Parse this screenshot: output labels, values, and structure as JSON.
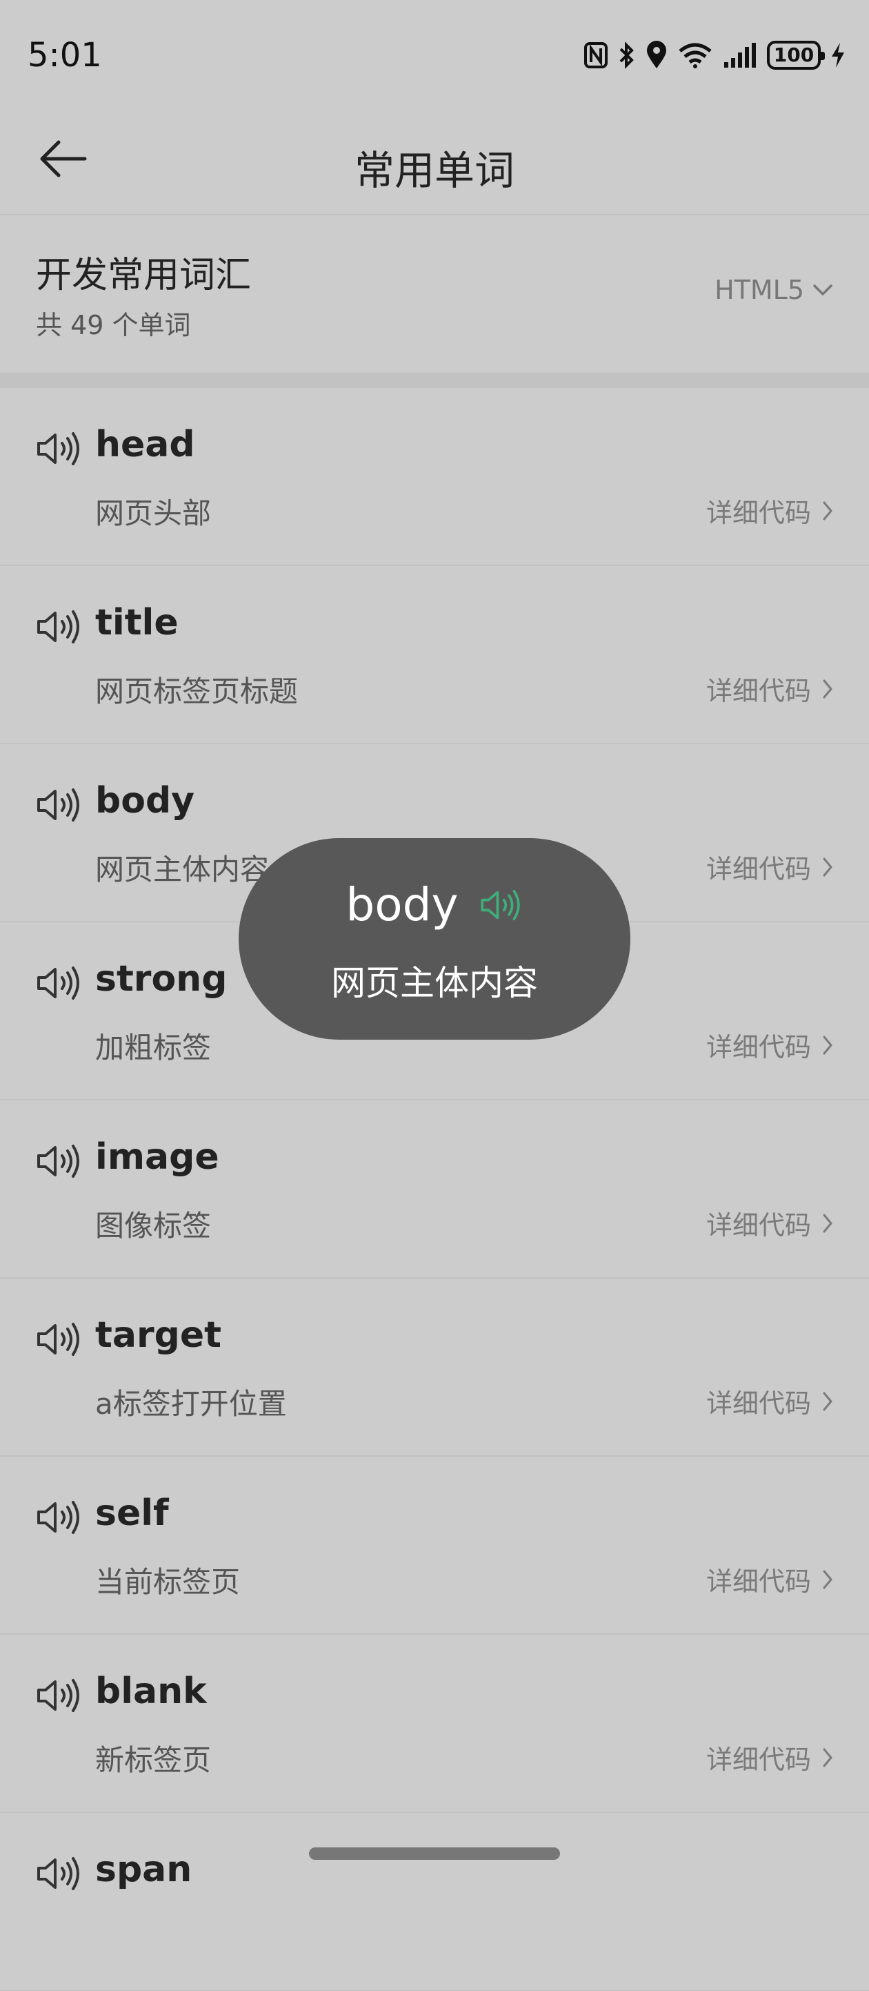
{
  "status": {
    "time": "5:01",
    "battery": "100"
  },
  "topbar": {
    "title": "常用单词"
  },
  "header": {
    "title": "开发常用词汇",
    "subtitle": "共 49 个单词",
    "selector": "HTML5"
  },
  "detail_label": "详细代码",
  "words": [
    {
      "word": "head",
      "meaning": "网页头部"
    },
    {
      "word": "title",
      "meaning": "网页标签页标题"
    },
    {
      "word": "body",
      "meaning": "网页主体内容"
    },
    {
      "word": "strong",
      "meaning": "加粗标签"
    },
    {
      "word": "image",
      "meaning": "图像标签"
    },
    {
      "word": "target",
      "meaning": "a标签打开位置"
    },
    {
      "word": "self",
      "meaning": "当前标签页"
    },
    {
      "word": "blank",
      "meaning": "新标签页"
    },
    {
      "word": "span",
      "meaning": ""
    }
  ],
  "toast": {
    "word": "body",
    "meaning": "网页主体内容",
    "accent": "#3fae7a"
  }
}
